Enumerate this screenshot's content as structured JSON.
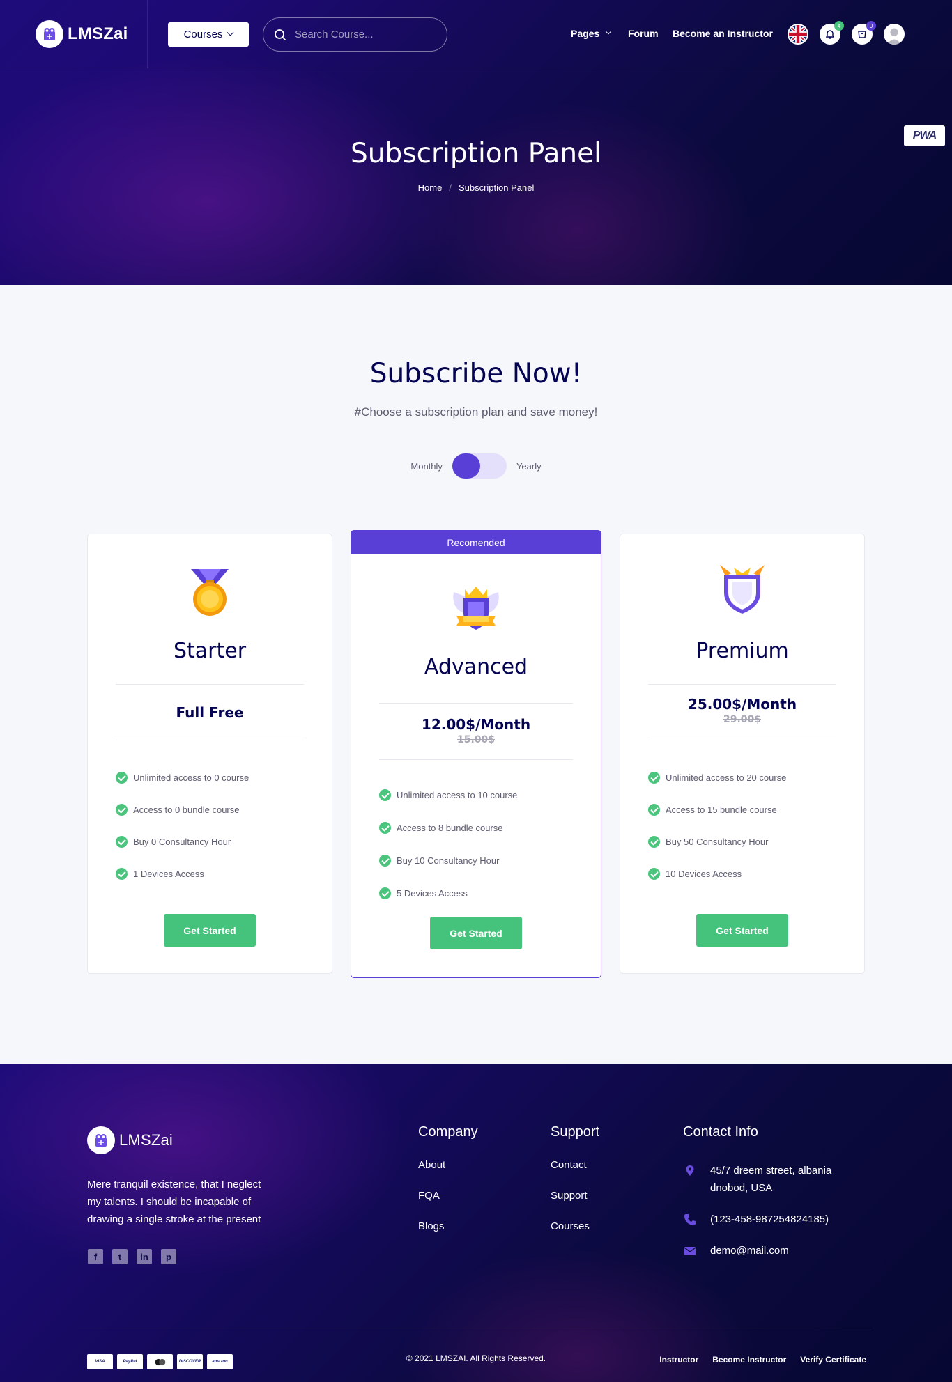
{
  "header": {
    "logo_text": "LMSZai",
    "courses_label": "Courses",
    "search_placeholder": "Search Course...",
    "nav": {
      "pages": "Pages",
      "forum": "Forum",
      "become_instructor": "Become an Instructor"
    },
    "notification_count": "4",
    "cart_count": "0",
    "pwa_badge": "PWA"
  },
  "hero": {
    "title": "Subscription Panel",
    "breadcrumb": {
      "home": "Home",
      "separator": "/",
      "current": "Subscription Panel"
    }
  },
  "subscribe": {
    "title": "Subscribe Now!",
    "subtitle": "#Choose a subscription plan and save money!",
    "toggle": {
      "left": "Monthly",
      "right": "Yearly"
    }
  },
  "plans": [
    {
      "name": "Starter",
      "price": "Full Free",
      "old_price": "",
      "features": [
        "Unlimited access to 0 course",
        "Access to 0 bundle course",
        "Buy 0 Consultancy Hour",
        "1 Devices Access"
      ],
      "cta": "Get Started"
    },
    {
      "badge": "Recomended",
      "name": "Advanced",
      "price": "12.00$/Month",
      "old_price": "15.00$",
      "features": [
        "Unlimited access to 10 course",
        "Access to 8 bundle course",
        "Buy 10 Consultancy Hour",
        "5 Devices Access"
      ],
      "cta": "Get Started"
    },
    {
      "name": "Premium",
      "price": "25.00$/Month",
      "old_price": "29.00$",
      "features": [
        "Unlimited access to 20 course",
        "Access to 15 bundle course",
        "Buy 50 Consultancy Hour",
        "10 Devices Access"
      ],
      "cta": "Get Started"
    }
  ],
  "footer": {
    "logo_text": "LMSZai",
    "description": "Mere tranquil existence, that I neglect my talents. I should be incapable of drawing a single stroke at the present",
    "company": {
      "title": "Company",
      "links": [
        "About",
        "FQA",
        "Blogs"
      ]
    },
    "support": {
      "title": "Support",
      "links": [
        "Contact",
        "Support",
        "Courses"
      ]
    },
    "contact": {
      "title": "Contact Info",
      "address": "45/7 dreem street, albania dnobod, USA",
      "phone": "(123-458-987254824185)",
      "email": "demo@mail.com"
    },
    "payments": [
      "VISA",
      "PayPal",
      "MasterCard",
      "DISCOVER",
      "amazon"
    ],
    "copyright": "© 2021 LMSZAI. All Rights Reserved.",
    "bottom_links": [
      "Instructor",
      "Become Instructor",
      "Verify Certificate"
    ]
  },
  "colors": {
    "accent": "#5a3fd6",
    "success": "#45c37c",
    "navy": "#040453",
    "hero_dark": "#0b0a3e"
  }
}
